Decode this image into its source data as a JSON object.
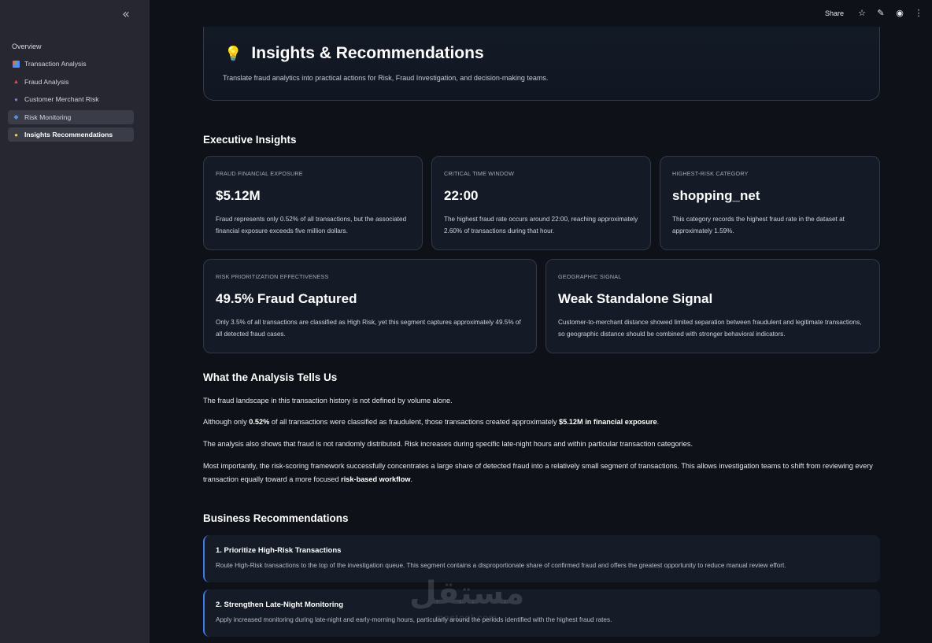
{
  "sidebar": {
    "collapse_icon": "double-chevron-left-icon",
    "overview": "Overview",
    "items": [
      {
        "label": "Transaction Analysis",
        "icon": "bar-chart-icon"
      },
      {
        "label": "Fraud Analysis",
        "icon": "alarm-icon"
      },
      {
        "label": "Customer Merchant Risk",
        "icon": "people-icon"
      },
      {
        "label": "Risk Monitoring",
        "icon": "shield-icon"
      },
      {
        "label": "Insights Recommendations",
        "icon": "lightbulb-icon"
      }
    ]
  },
  "header": {
    "share": "Share",
    "icons": [
      "star-icon",
      "pencil-icon",
      "github-icon",
      "more-vertical-icon"
    ]
  },
  "hero": {
    "title": "Insights & Recommendations",
    "subtitle": "Translate fraud analytics into practical actions for Risk, Fraud Investigation, and decision-making teams."
  },
  "executive": {
    "title": "Executive Insights",
    "cards": [
      {
        "label": "FRAUD FINANCIAL EXPOSURE",
        "value": "$5.12M",
        "desc": "Fraud represents only 0.52% of all transactions, but the associated financial exposure exceeds five million dollars."
      },
      {
        "label": "CRITICAL TIME WINDOW",
        "value": "22:00",
        "desc": "The highest fraud rate occurs around 22:00, reaching approximately 2.60% of transactions during that hour."
      },
      {
        "label": "HIGHEST-RISK CATEGORY",
        "value": "shopping_net",
        "desc": "This category records the highest fraud rate in the dataset at approximately 1.59%."
      },
      {
        "label": "RISK PRIORITIZATION EFFECTIVENESS",
        "value": "49.5% Fraud Captured",
        "desc": "Only 3.5% of all transactions are classified as High Risk, yet this segment captures approximately 49.5% of all detected fraud cases."
      },
      {
        "label": "GEOGRAPHIC SIGNAL",
        "value": "Weak Standalone Signal",
        "desc": "Customer-to-merchant distance showed limited separation between fraudulent and legitimate transactions, so geographic distance should be combined with stronger behavioral indicators."
      }
    ]
  },
  "analysis": {
    "title": "What the Analysis Tells Us",
    "p1": "The fraud landscape in this transaction history is not defined by volume alone.",
    "p2_a": "Although only ",
    "p2_b": "0.52%",
    "p2_c": " of all transactions were classified as fraudulent, those transactions created approximately ",
    "p2_d": "$5.12M in financial exposure",
    "p2_e": ".",
    "p3": "The analysis also shows that fraud is not randomly distributed. Risk increases during specific late-night hours and within particular transaction categories.",
    "p4_a": "Most importantly, the risk-scoring framework successfully concentrates a large share of detected fraud into a relatively small segment of transactions. This allows investigation teams to shift from reviewing every transaction equally toward a more focused ",
    "p4_b": "risk-based workflow",
    "p4_c": "."
  },
  "recommendations": {
    "title": "Business Recommendations",
    "items": [
      {
        "title": "1. Prioritize High-Risk Transactions",
        "desc": "Route High-Risk transactions to the top of the investigation queue. This segment contains a disproportionate share of confirmed fraud and offers the greatest opportunity to reduce manual review effort."
      },
      {
        "title": "2. Strengthen Late-Night Monitoring",
        "desc": "Apply increased monitoring during late-night and early-morning hours, particularly around the periods identified with the highest fraud rates."
      }
    ]
  },
  "watermark": {
    "logo": "مستقل",
    "text": "mostaql.com"
  }
}
